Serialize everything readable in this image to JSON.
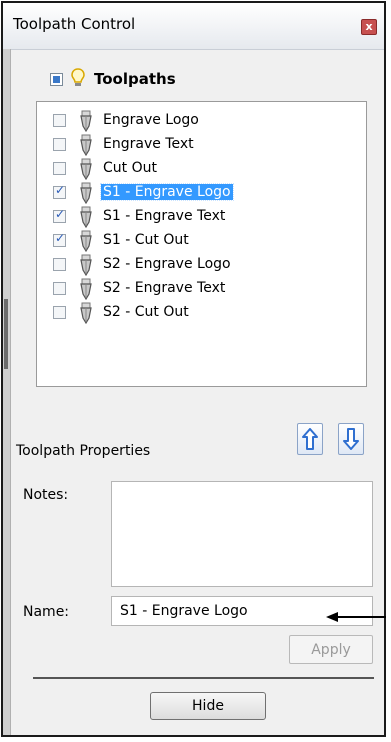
{
  "window": {
    "title": "Toolpath Control",
    "close_label": "x"
  },
  "toolpaths": {
    "header_label": "Toolpaths",
    "items": [
      {
        "label": "Engrave Logo",
        "checked": false,
        "selected": false
      },
      {
        "label": "Engrave Text",
        "checked": false,
        "selected": false
      },
      {
        "label": "Cut Out",
        "checked": false,
        "selected": false
      },
      {
        "label": "S1 - Engrave Logo",
        "checked": true,
        "selected": true
      },
      {
        "label": "S1 - Engrave Text",
        "checked": true,
        "selected": false
      },
      {
        "label": "S1 - Cut Out",
        "checked": true,
        "selected": false
      },
      {
        "label": "S2 - Engrave Logo",
        "checked": false,
        "selected": false
      },
      {
        "label": "S2 - Engrave Text",
        "checked": false,
        "selected": false
      },
      {
        "label": "S2 - Cut Out",
        "checked": false,
        "selected": false
      }
    ]
  },
  "properties": {
    "section_label": "Toolpath Properties",
    "notes_label": "Notes:",
    "notes_value": "",
    "name_label": "Name:",
    "name_value": "S1 - Engrave Logo",
    "apply_label": "Apply",
    "move_up_icon": "arrow-up-icon",
    "move_down_icon": "arrow-down-icon"
  },
  "footer": {
    "hide_label": "Hide"
  },
  "colors": {
    "selection": "#3399ff",
    "arrow_blue": "#2f6fd0",
    "bulb": "#e4b800"
  }
}
